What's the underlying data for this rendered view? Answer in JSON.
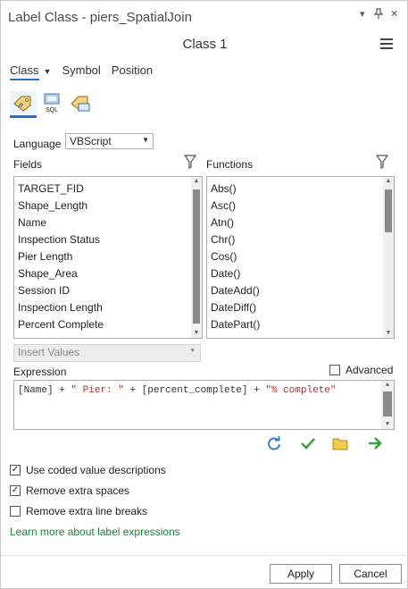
{
  "window": {
    "title": "Label Class - piers_SpatialJoin",
    "pin_label": "⬡",
    "close_label": "✕",
    "dropdown_label": "▾"
  },
  "header": {
    "class_title": "Class 1"
  },
  "tabs": [
    {
      "label": "Class",
      "active": true
    },
    {
      "label": "Symbol",
      "active": false
    },
    {
      "label": "Position",
      "active": false
    }
  ],
  "iconbar": [
    {
      "icon": "expression-icon",
      "sql": ""
    },
    {
      "icon": "sql-query-icon",
      "sql": "SQL"
    },
    {
      "icon": "label-placement-icon",
      "sql": ""
    }
  ],
  "language": {
    "label": "Language",
    "value": "VBScript"
  },
  "fields": {
    "label": "Fields",
    "items": [
      "TARGET_FID",
      "Shape_Length",
      "Name",
      "Inspection Status",
      "Pier Length",
      "Shape_Area",
      "Session ID",
      "Inspection Length",
      "Percent Complete"
    ]
  },
  "functions": {
    "label": "Functions",
    "items": [
      "Abs()",
      "Asc()",
      "Atn()",
      "Chr()",
      "Cos()",
      "Date()",
      "DateAdd()",
      "DateDiff()",
      "DatePart()"
    ]
  },
  "insert_values": {
    "label": "Insert Values"
  },
  "expression": {
    "label": "Expression",
    "advanced_label": "Advanced",
    "part1": "[Name] + ",
    "part2": "\" Pier: \"",
    "part3": " + [percent_complete] + ",
    "part4": "\"% complete\""
  },
  "options": [
    {
      "label": "Use coded value descriptions",
      "checked": true
    },
    {
      "label": "Remove extra spaces",
      "checked": true
    },
    {
      "label": "Remove extra line breaks",
      "checked": false
    }
  ],
  "learn_more": "Learn more about label expressions",
  "buttons": {
    "apply": "Apply",
    "cancel": "Cancel"
  },
  "colors": {
    "accent": "#2a6fc9",
    "verify": "#3aa03a",
    "folder": "#e8b630",
    "run": "#3aa03a",
    "reset": "#3b7fc4",
    "link": "#1a7f3a"
  }
}
